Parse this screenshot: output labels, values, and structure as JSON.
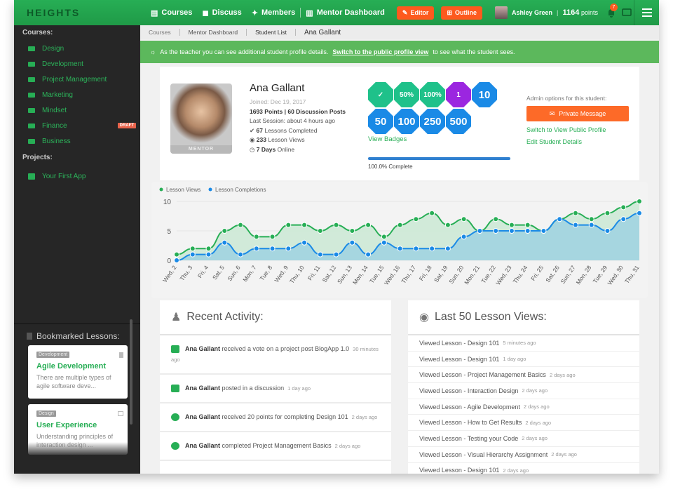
{
  "brand": "HEIGHTS",
  "nav": [
    {
      "label": "Courses",
      "icon": "book-icon"
    },
    {
      "label": "Discuss",
      "icon": "comments-icon"
    },
    {
      "label": "Members",
      "icon": "users-icon"
    },
    {
      "label": "Mentor Dashboard",
      "icon": "bar-chart-icon"
    }
  ],
  "editor_label": "Editor",
  "outline_label": "Outline",
  "user": {
    "name": "Ashley Green",
    "points": "1164",
    "points_label": "points",
    "notifications": "7"
  },
  "sidebar": {
    "courses_heading": "Courses:",
    "courses": [
      {
        "label": "Design"
      },
      {
        "label": "Development"
      },
      {
        "label": "Project Management"
      },
      {
        "label": "Marketing"
      },
      {
        "label": "Mindset"
      },
      {
        "label": "Finance",
        "badge": "DRAFT"
      },
      {
        "label": "Business"
      }
    ],
    "projects_heading": "Projects:",
    "projects": [
      {
        "label": "Your First App"
      }
    ]
  },
  "bookmarks": {
    "heading": "Bookmarked Lessons:",
    "items": [
      {
        "tag": "Development",
        "title": "Agile Development",
        "desc": "There are multiple types of agile software deve..."
      },
      {
        "tag": "Design",
        "title": "User Experience",
        "desc": "Understanding principles of interaction design ..."
      }
    ]
  },
  "breadcrumb": [
    "Courses",
    "Mentor Dashboard",
    "Student List",
    "Ana Gallant"
  ],
  "alert": {
    "text": "As the teacher you can see additional student profile details.",
    "link": "Switch to the public profile view",
    "after": "to see what the student sees."
  },
  "profile": {
    "name": "Ana Gallant",
    "joined": "Joined: Dec 19, 2017",
    "points_posts": "1693 Points | 60 Discussion Posts",
    "last_session": "Last Session: about 4 hours ago",
    "lessons_completed": "67",
    "lessons_completed_label": "Lessons Completed",
    "lesson_views": "233",
    "lesson_views_label": "Lesson Views",
    "days_online": "7 Days",
    "days_online_label": "Online",
    "photo_label": "MENTOR"
  },
  "badges": {
    "row1": [
      {
        "text": "✓",
        "color": "green"
      },
      {
        "text": "50%",
        "color": "green"
      },
      {
        "text": "100%",
        "color": "green"
      },
      {
        "text": "1",
        "color": "purple"
      },
      {
        "text": "10",
        "color": "blue"
      }
    ],
    "row2": [
      {
        "text": "50",
        "color": "blue"
      },
      {
        "text": "100",
        "color": "blue"
      },
      {
        "text": "250",
        "color": "blue"
      },
      {
        "text": "500",
        "color": "blue"
      }
    ],
    "view_link": "View Badges",
    "progress": 1.0,
    "progress_label": "100.0% Complete"
  },
  "admin": {
    "heading": "Admin options for this student:",
    "pm_label": "Private Message",
    "switch_link": "Switch to View Public Profile",
    "edit_link": "Edit Student Details"
  },
  "chart_data": {
    "type": "area",
    "categories": [
      "Wed, 2",
      "Thu, 3",
      "Fri, 4",
      "Sat, 5",
      "Sun, 6",
      "Mon, 7",
      "Tue, 8",
      "Wed, 9",
      "Thu, 10",
      "Fri, 11",
      "Sat, 12",
      "Sun, 13",
      "Mon, 14",
      "Tue, 15",
      "Wed, 16",
      "Thu, 17",
      "Fri, 18",
      "Sat, 19",
      "Sun, 20",
      "Mon, 21",
      "Tue, 22",
      "Wed, 23",
      "Thu, 24",
      "Fri, 25",
      "Sat, 26",
      "Sun, 27",
      "Mon, 28",
      "Tue, 29",
      "Wed, 30",
      "Thu, 31"
    ],
    "series": [
      {
        "name": "Lesson Views",
        "color": "#27ae55",
        "fill": "#cde9d6",
        "values": [
          1,
          2,
          2,
          5,
          6,
          4,
          4,
          6,
          6,
          5,
          6,
          5,
          6,
          4,
          6,
          7,
          8,
          6,
          7,
          5,
          7,
          6,
          6,
          5,
          7,
          8,
          7,
          8,
          9,
          10
        ]
      },
      {
        "name": "Lesson Completions",
        "color": "#1a8ae6",
        "fill": "#a3d5e0",
        "values": [
          0,
          1,
          1,
          3,
          1,
          2,
          2,
          2,
          3,
          1,
          1,
          3,
          1,
          3,
          2,
          2,
          2,
          2,
          4,
          5,
          5,
          5,
          5,
          5,
          7,
          6,
          6,
          5,
          7,
          8
        ]
      }
    ],
    "yticks": [
      0,
      5,
      10
    ],
    "ylim": [
      0,
      10
    ],
    "legend": "top-left",
    "grid": true
  },
  "activity": {
    "heading": "Recent Activity:",
    "items": [
      {
        "icon": "briefcase-icon",
        "name": "Ana Gallant",
        "text": "received a vote on a project post BlogApp 1.0",
        "time": "30 minutes ago"
      },
      {
        "icon": "comment-icon",
        "name": "Ana Gallant",
        "text": "posted in a discussion",
        "time": "1 day ago"
      },
      {
        "icon": "plus-circle-icon",
        "name": "Ana Gallant",
        "text": "received 20 points for completing Design 101",
        "time": "2 days ago"
      },
      {
        "icon": "check-circle-icon",
        "name": "Ana Gallant",
        "text": "completed Project Management Basics",
        "time": "2 days ago"
      }
    ]
  },
  "views": {
    "heading": "Last 50 Lesson Views:",
    "items": [
      {
        "text": "Viewed Lesson - Design 101",
        "time": "5 minutes ago"
      },
      {
        "text": "Viewed Lesson - Design 101",
        "time": "1 day ago"
      },
      {
        "text": "Viewed Lesson - Project Management Basics",
        "time": "2 days ago"
      },
      {
        "text": "Viewed Lesson - Interaction Design",
        "time": "2 days ago"
      },
      {
        "text": "Viewed Lesson - Agile Development",
        "time": "2 days ago"
      },
      {
        "text": "Viewed Lesson - How to Get Results",
        "time": "2 days ago"
      },
      {
        "text": "Viewed Lesson - Testing your Code",
        "time": "2 days ago"
      },
      {
        "text": "Viewed Lesson - Visual Hierarchy Assignment",
        "time": "2 days ago"
      },
      {
        "text": "Viewed Lesson - Design 101",
        "time": "2 days ago"
      }
    ]
  }
}
